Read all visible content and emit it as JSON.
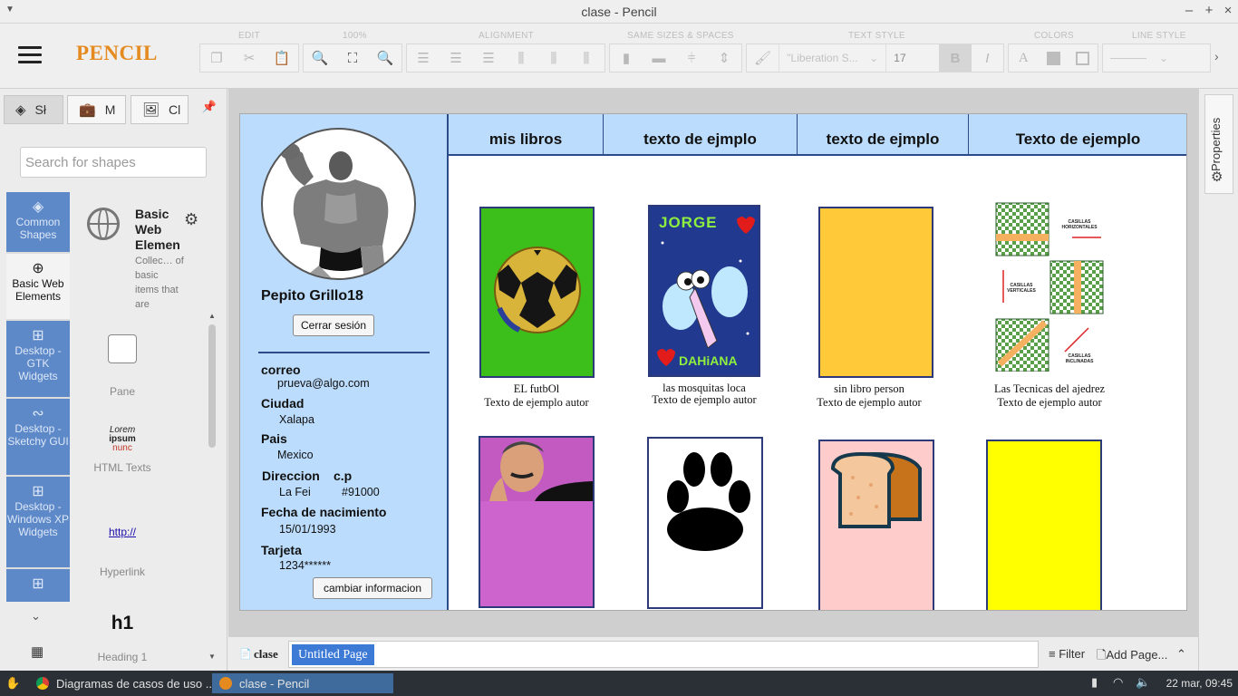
{
  "window": {
    "title": "clase - Pencil"
  },
  "app": {
    "logo": "PENCIL"
  },
  "toolbar": {
    "groups": {
      "edit": "EDIT",
      "zoom": "100%",
      "alignment": "ALIGNMENT",
      "same_sizes": "SAME SIZES & SPACES",
      "text_style": "TEXT STYLE",
      "colors": "COLORS",
      "line_style": "LINE STYLE"
    },
    "font_name": "\"Liberation S...",
    "font_size": "17",
    "bold": "B",
    "italic": "I",
    "text_color": "A"
  },
  "left_panel": {
    "tabs": [
      "Sł",
      "M",
      "Cl"
    ],
    "search_placeholder": "Search for shapes",
    "categories": [
      {
        "label": "Common Shapes",
        "icon": "layers-icon"
      },
      {
        "label": "Basic Web Elements",
        "icon": "globe-icon"
      },
      {
        "label": "Desktop - GTK Widgets",
        "icon": "grid-icon"
      },
      {
        "label": "Desktop - Sketchy GUI",
        "icon": "squiggle-icon"
      },
      {
        "label": "Desktop - Windows XP Widgets",
        "icon": "grid-icon"
      }
    ],
    "collection": {
      "title": "Basic Web Elemen",
      "description": "Collec… of basic items that are"
    },
    "shapes": [
      {
        "label": "Pane"
      },
      {
        "label": "HTML Texts",
        "sample_lines": [
          "Lorem",
          "ipsum",
          "nunc"
        ]
      },
      {
        "label": "Hyperlink",
        "sample": "http://"
      },
      {
        "label": "Heading 1",
        "sample": "h1"
      }
    ]
  },
  "canvas": {
    "profile": {
      "name": "Pepito Grillo18",
      "logout_button": "Cerrar sesión",
      "fields": {
        "email_label": "correo",
        "email_value": "prueva@algo.com",
        "city_label": "Ciudad",
        "city_value": "Xalapa",
        "country_label": "Pais",
        "country_value": "Mexico",
        "address_label": "Direccion",
        "zip_label": "c.p",
        "address_value": "La Fei",
        "zip_value": "#91000",
        "dob_label": "Fecha de nacimiento",
        "dob_value": "15/01/1993",
        "card_label": "Tarjeta",
        "card_value": "1234******"
      },
      "change_button": "cambiar informacion"
    },
    "nav": [
      "mis libros",
      "texto de ejmplo",
      "texto de ejmplo",
      "Texto de ejemplo"
    ],
    "books": [
      {
        "title": "EL futbOl",
        "author": "Texto de ejemplo autor",
        "color": "#3cbf1a"
      },
      {
        "title": "las mosquitas loca",
        "author": "Texto de ejemplo autor",
        "color": "#213a8f",
        "cover_text_top": "JORGE",
        "cover_text_bottom": "DAHiANA"
      },
      {
        "title": "sin libro  person",
        "author": "Texto de ejemplo autor",
        "color": "#ffc93a"
      },
      {
        "title": "Las Tecnicas del ajedrez",
        "author": "Texto de ejemplo autor",
        "color": "#ffffff",
        "cover_labels": [
          "CASILLAS HORIZONTALES",
          "CASILLAS VERTICALES",
          "CASILLAS INCLINADAS"
        ]
      },
      {
        "color": "#cd63cd"
      },
      {
        "color": "#ffffff"
      },
      {
        "color": "#ffcccc"
      },
      {
        "color": "#ffff00"
      }
    ]
  },
  "page_bar": {
    "document": "clase",
    "page_tab": "Untitled Page",
    "filter": "Filter",
    "add_page": "Add Page..."
  },
  "right_panel": {
    "properties": "Properties"
  },
  "taskbar": {
    "items": [
      "Diagramas de casos de uso ...",
      "clase - Pencil"
    ],
    "clock": "22 mar, 09:45"
  }
}
